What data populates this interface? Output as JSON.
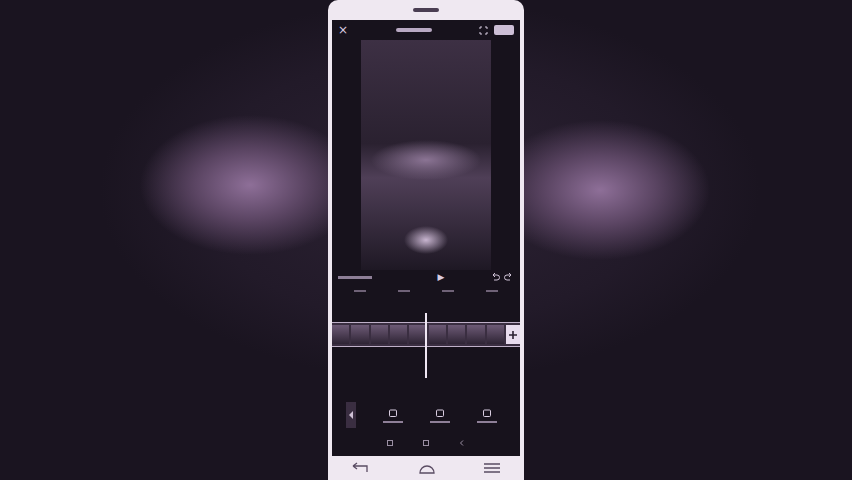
{
  "editor": {
    "close": "×",
    "play": "▶"
  }
}
